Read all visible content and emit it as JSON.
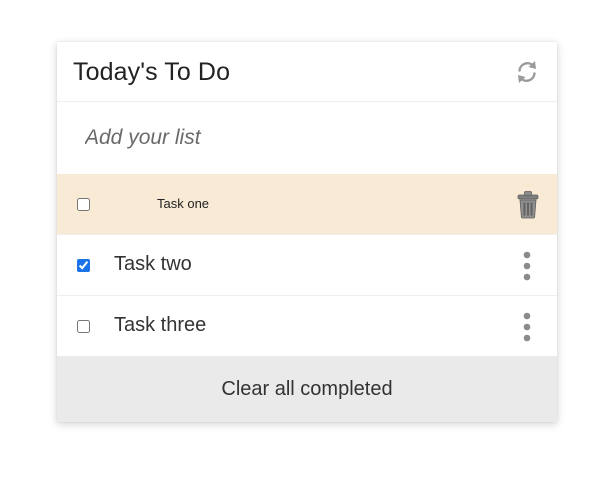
{
  "app": {
    "title": "Today's To Do"
  },
  "add": {
    "placeholder": "Add your list"
  },
  "tasks": [
    {
      "label": "Task one",
      "checked": false,
      "hovered": true,
      "action_icon": "trash-icon"
    },
    {
      "label": "Task two",
      "checked": true,
      "hovered": false,
      "action_icon": "more-vertical-icon"
    },
    {
      "label": "Task three",
      "checked": false,
      "hovered": false,
      "action_icon": "more-vertical-icon"
    }
  ],
  "footer": {
    "clear_label": "Clear all completed"
  },
  "colors": {
    "hover_row": "#f9ead6",
    "footer_bg": "#eaeaea",
    "icon_gray": "#8a8a8a",
    "checkbox_accent": "#1a73e8"
  },
  "icons": {
    "refresh": "refresh-icon",
    "trash": "trash-icon",
    "more": "more-vertical-icon"
  }
}
